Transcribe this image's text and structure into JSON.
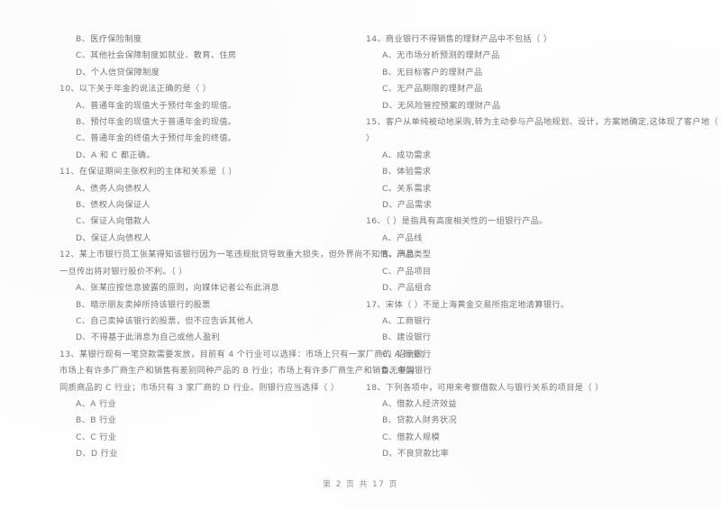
{
  "document": {
    "type": "scanned-exam-paper",
    "footer": "第 2 页  共 17 页",
    "text_color": "#767676",
    "background_color": "#fefefe"
  },
  "left_column": {
    "top_options": [
      {
        "label": "B、医疗保险制度"
      },
      {
        "label": "C、其他社会保障制度如就业、教育、住房"
      },
      {
        "label": "D、个人信贷保障制度"
      }
    ],
    "questions": [
      {
        "number": "10",
        "stem": "10、以下关于年金的说法正确的是（      ）",
        "options": [
          "A、普通年金的现值大于预付年金的现值。",
          "B、预付年金的现值大于普通年金的现值。",
          "C、普通年金的终值大于预付年金的终值。",
          "D、A 和 C 都正确。"
        ]
      },
      {
        "number": "11",
        "stem": "11、在保证期间主张权利的主体和关系是（      ）",
        "options": [
          "A、债务人向债权人",
          "B、债权人向保证人",
          "C、保证人向借款人",
          "D、保证人向债权人"
        ]
      },
      {
        "number": "12",
        "stem": "12、某上市银行员工张某得知该银行因为一笔违规批贷导致重大损失，但外界尚不知情。消息",
        "stem_cont": "一旦传出将对银行股价不利。（      ）",
        "options": [
          "A、张某应按信息披露的原则，向媒体记者公布此消息",
          "B、暗示朋友卖掉所持该银行的股票",
          "C、自己卖掉该银行的股票，但不应告诉其他人",
          "D、不得基于此消息为自己或他人盈利"
        ]
      },
      {
        "number": "13",
        "stem": "13、某银行现有一笔贷款需要发放，目前有 4 个行业可以选择：市场上只有一家厂商的 A 行业；",
        "stem_cont": "市场上有许多厂商生产和销售有差别同种产品的 B 行业；市场上有许多厂商生产和销售无差异",
        "stem_cont2": "同质商品的 C 行业；市场只有 3 家厂商的 D 行业。则银行应当选择（      ）",
        "options": [
          "A、A 行业",
          "B、B 行业",
          "C、C 行业",
          "D、D 行业"
        ]
      }
    ]
  },
  "right_column": {
    "questions": [
      {
        "number": "14",
        "stem": "14、商业银行不得销售的理财产品中不包括（      ）",
        "options": [
          "A、无市场分析预测的理财产品",
          "B、无目标客户的理财产品",
          "C、无产品期限的理财产品",
          "D、无风险管控预案的理财产品"
        ]
      },
      {
        "number": "15",
        "stem": "15、客户从单纯被动地采购,转为主动参与产品地规划、设计，方案她确定,这体现了客户地（",
        "stem_cont": "）",
        "options": [
          "A、成功需求",
          "B、体验需求",
          "C、关系需求",
          "D、产品需求"
        ]
      },
      {
        "number": "16",
        "stem": "16、（      ）是指具有高度相关性的一组银行产品。",
        "options": [
          "A、产品线",
          "B、产品类型",
          "C、产品项目",
          "D、产品组合"
        ]
      },
      {
        "number": "17",
        "stem": "17、宋体（      ）不是上海黄金交易所指定地清算银行。",
        "options": [
          "A、工商银行",
          "B、建设银行",
          "C、招商银行",
          "D、中国银行"
        ]
      },
      {
        "number": "18",
        "stem": "18、下列各项中，可用来考察借款人与银行关系的项目是（      ）",
        "options": [
          "A、借款人经济效益",
          "B、贷款人财务状况",
          "C、借款人规模",
          "D、不良贷款比率"
        ]
      }
    ]
  }
}
